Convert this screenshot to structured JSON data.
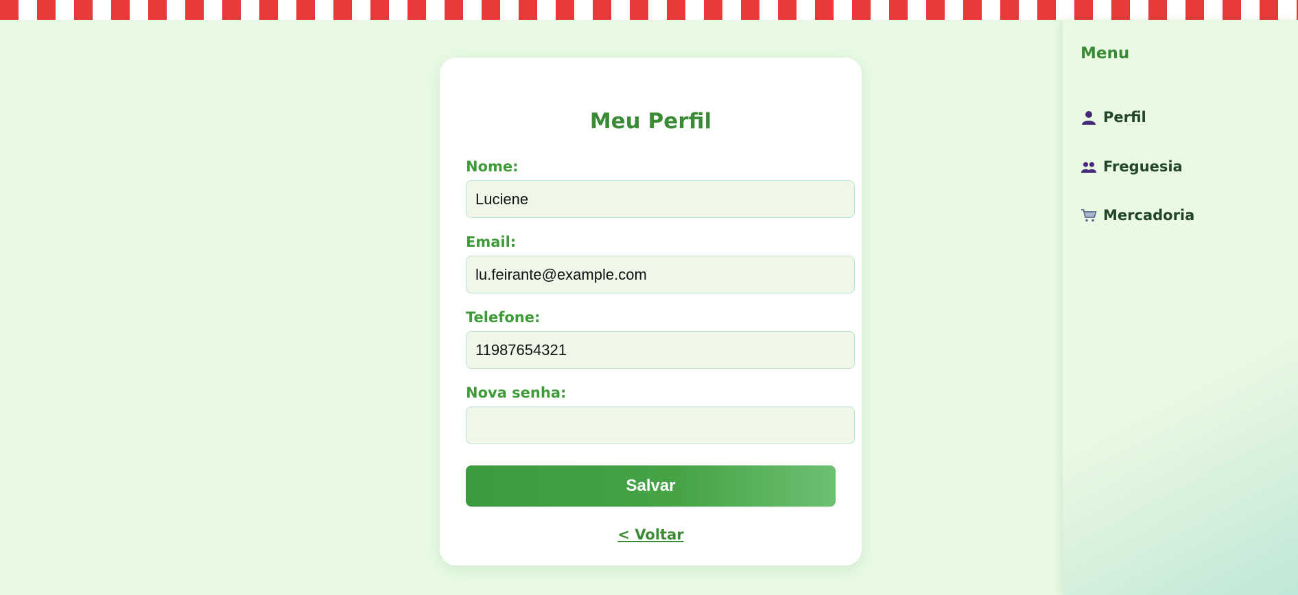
{
  "form": {
    "title": "Meu Perfil",
    "fields": [
      {
        "label": "Nome:",
        "value": "Luciene",
        "type": "text"
      },
      {
        "label": "Email:",
        "value": "lu.feirante@example.com",
        "type": "email"
      },
      {
        "label": "Telefone:",
        "value": "11987654321",
        "type": "tel"
      },
      {
        "label": "Nova senha:",
        "value": "",
        "type": "password"
      }
    ],
    "save_label": "Salvar",
    "back_label": "< Voltar"
  },
  "sidebar": {
    "title": "Menu",
    "items": [
      {
        "label": "Perfil",
        "icon": "person-icon"
      },
      {
        "label": "Freguesia",
        "icon": "people-icon"
      },
      {
        "label": "Mercadoria",
        "icon": "shopping-cart-icon"
      }
    ]
  },
  "colors": {
    "background": "#e8fae3",
    "accent": "#3a8a36",
    "awning_red": "#e83a3a",
    "button_start": "#3c9a40",
    "button_end": "#6cc072",
    "icon_purple": "#4a2a7a"
  }
}
